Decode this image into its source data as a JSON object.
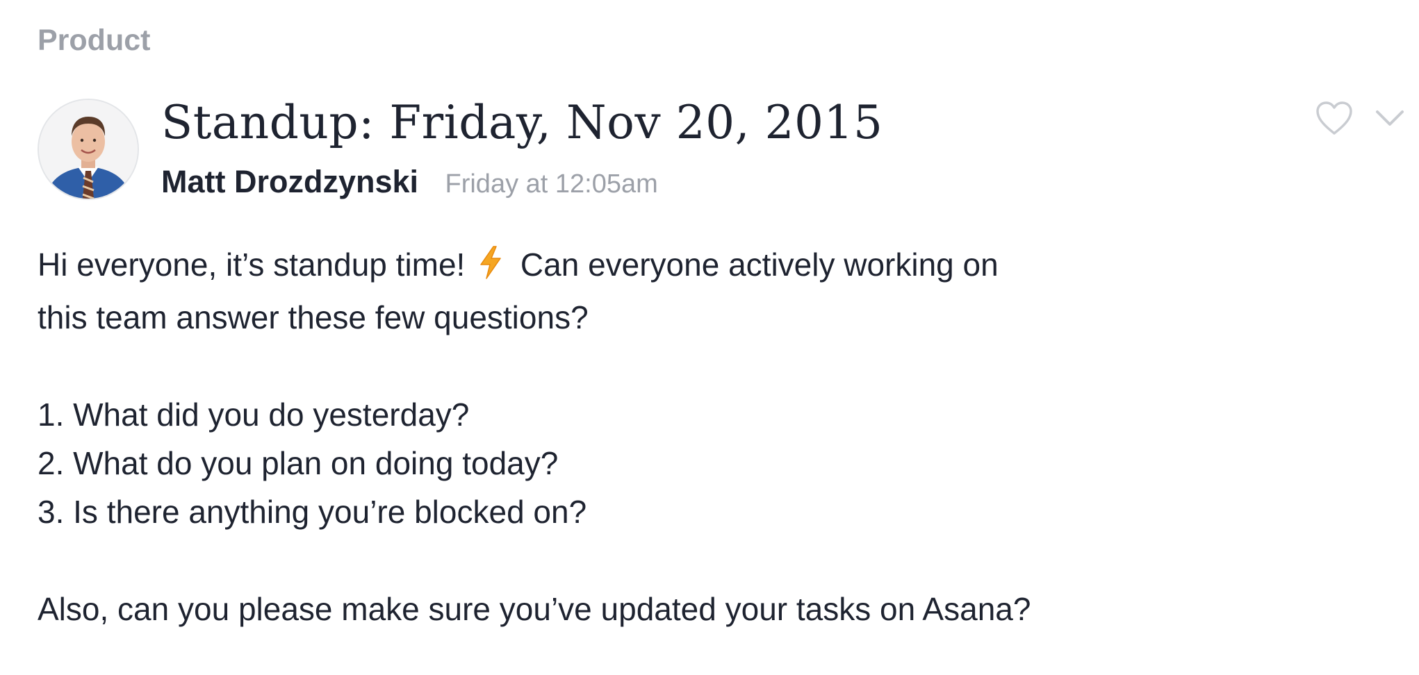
{
  "breadcrumb": {
    "label": "Product"
  },
  "post": {
    "title": "Standup: Friday, Nov 20, 2015",
    "author": "Matt Drozdzynski",
    "timestamp": "Friday at 12:05am",
    "body": {
      "intro_before_icon": "Hi everyone, it’s standup time!",
      "intro_icon": "lightning-bolt-icon",
      "intro_after_icon": "Can everyone actively working on",
      "intro_line2": "this team answer these few questions?",
      "questions": [
        "1. What did you do yesterday?",
        "2. What do you plan on doing today?",
        "3. Is there anything you’re blocked on?"
      ],
      "closing": "Also, can you please make sure you’ve updated your tasks on Asana?"
    }
  },
  "actions": {
    "like_icon": "heart-icon",
    "menu_icon": "chevron-down-icon"
  },
  "colors": {
    "text_primary": "#1e2330",
    "text_muted": "#9ca0a8",
    "icon_muted": "#c9ccd1",
    "bolt": "#f5a623"
  }
}
